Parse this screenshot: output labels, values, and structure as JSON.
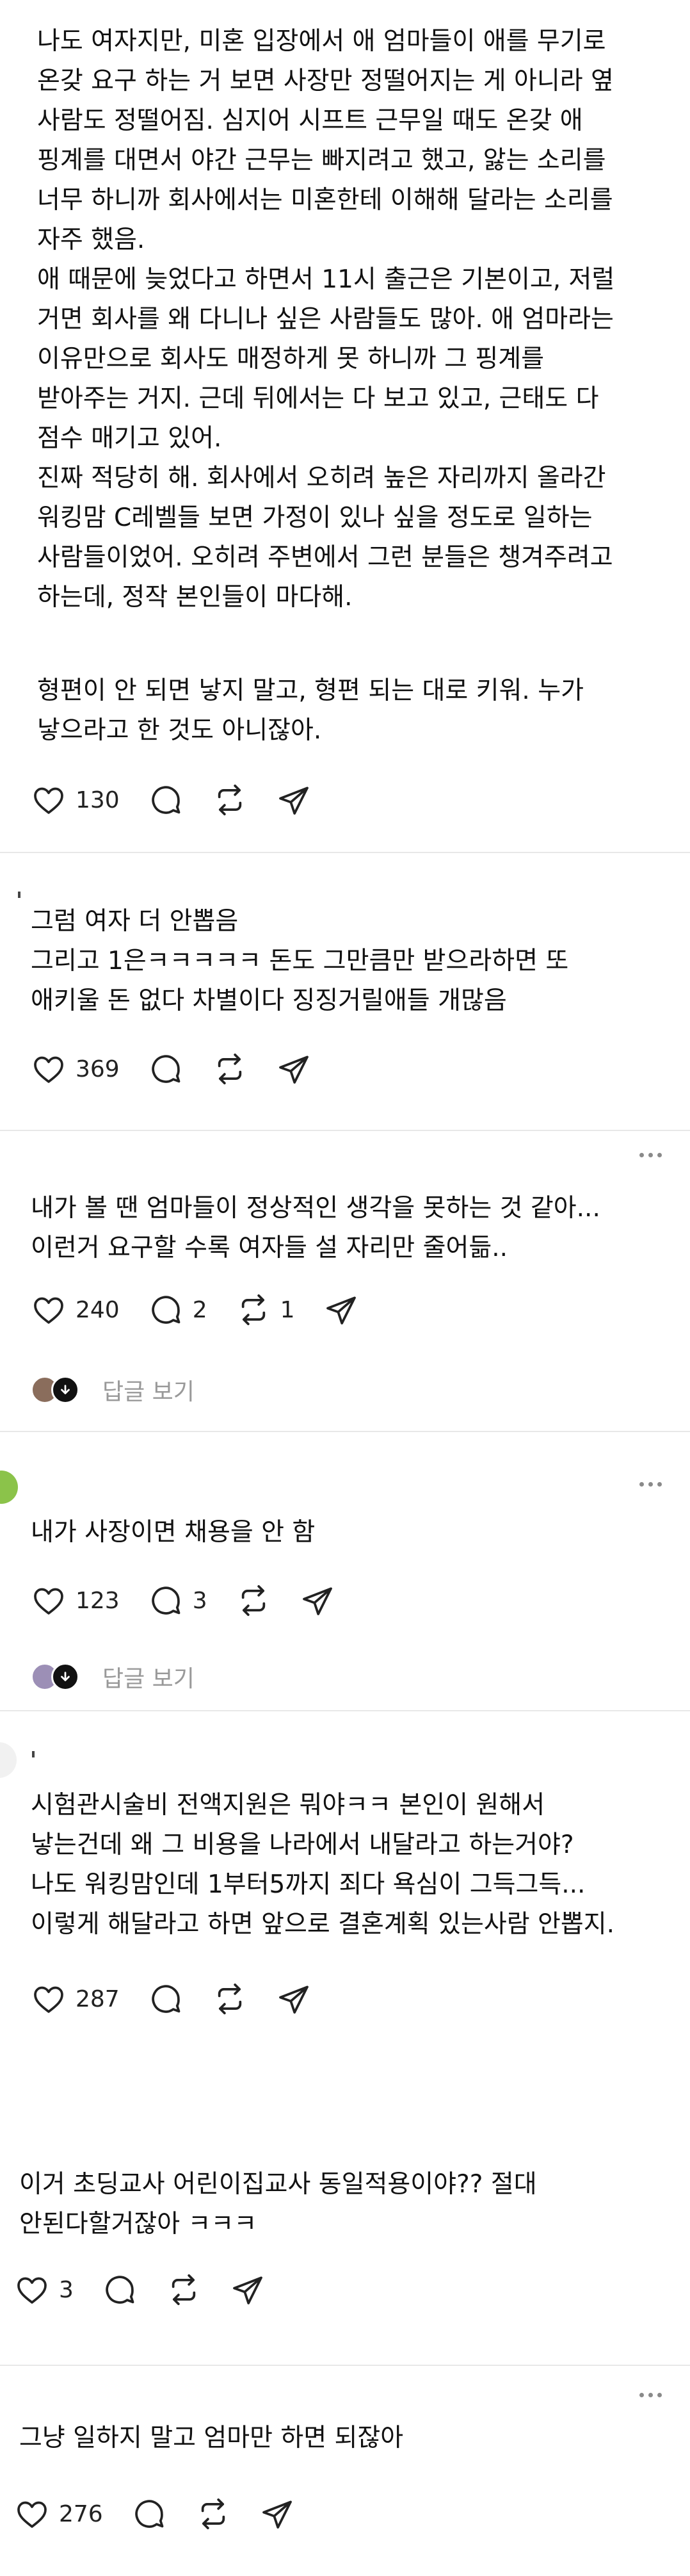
{
  "feed": {
    "posts": [
      {
        "body": "나도 여자지만, 미혼 입장에서 애 엄마들이 애를 무기로\n온갖 요구 하는 거 보면 사장만 정떨어지는 게 아니라 옆\n사람도 정떨어짐. 심지어 시프트 근무일 때도 온갖 애\n핑계를 대면서 야간 근무는 빠지려고 했고, 앓는 소리를\n너무 하니까 회사에서는 미혼한테 이해해 달라는 소리를\n자주 했음.\n애 때문에 늦었다고 하면서 11시 출근은 기본이고, 저럴\n거면 회사를 왜 다니나 싶은 사람들도 많아. 애 엄마라는\n이유만으로 회사도 매정하게 못 하니까 그 핑계를\n받아주는 거지. 근데 뒤에서는 다 보고 있고, 근태도 다\n점수 매기고 있어.\n진짜 적당히 해. 회사에서 오히려 높은 자리까지 올라간\n워킹맘 C레벨들 보면 가정이 있나 싶을 정도로 일하는\n사람들이었어. 오히려 주변에서 그런 분들은 챙겨주려고\n하는데, 정작 본인들이 마다해.",
        "body2": "형편이 안 되면 낳지 말고, 형편 되는 대로 키워. 누가\n낳으라고 한 것도 아니잖아.",
        "likes": "130",
        "comments": "",
        "reposts": ""
      },
      {
        "body": "그럼 여자 더 안뽑음\n그리고 1은ㅋㅋㅋㅋㅋ 돈도 그만큼만 받으라하면 또\n애키울 돈 없다 차별이다 징징거릴애들 개많음",
        "likes": "369",
        "comments": "",
        "reposts": ""
      },
      {
        "body": "내가 볼 땐 엄마들이 정상적인 생각을 못하는 것 같아...\n이런거 요구할 수록 여자들 설 자리만 줄어듦..",
        "likes": "240",
        "comments": "2",
        "reposts": "1",
        "replies_label": "답글 보기"
      },
      {
        "body": "내가 사장이면 채용을 안 함",
        "likes": "123",
        "comments": "3",
        "reposts": "",
        "replies_label": "답글 보기"
      },
      {
        "body": "시험관시술비 전액지원은 뭐야ㅋㅋ 본인이 원해서\n낳는건데 왜 그 비용을 나라에서 내달라고 하는거야?\n나도 워킹맘인데 1부터5까지 죄다 욕심이 그득그득...\n이렇게 해달라고 하면 앞으로 결혼계획 있는사람 안뽑지.",
        "likes": "287",
        "comments": "",
        "reposts": ""
      },
      {
        "body": "이거 초딩교사 어린이집교사 동일적용이야?? 절대\n안된다할거잖아 ㅋㅋㅋ",
        "likes": "3",
        "comments": "",
        "reposts": ""
      },
      {
        "body": "그냥 일하지 말고 엄마만 하면 되잖아",
        "likes": "276",
        "comments": "",
        "reposts": ""
      }
    ]
  },
  "icons": [
    "heart-icon",
    "comment-icon",
    "repost-icon",
    "share-icon",
    "more-icon",
    "arrow-down-icon"
  ],
  "colors": {
    "text": "#111111",
    "muted": "#999999",
    "divider": "#e8e8e8",
    "icon": "#222222",
    "avatar_green": "#8bc34a"
  }
}
